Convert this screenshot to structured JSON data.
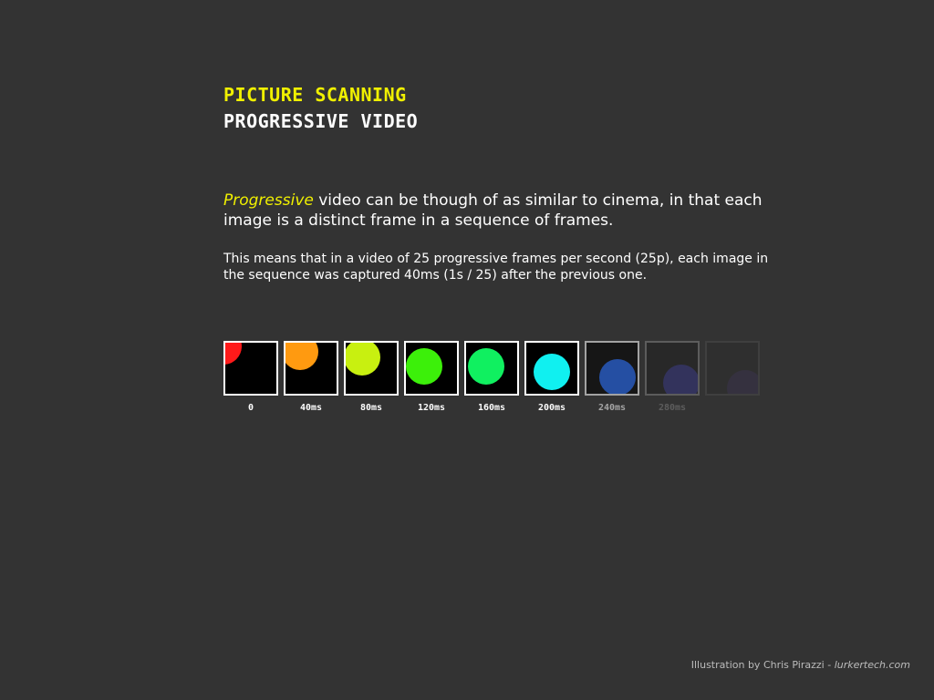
{
  "header": {
    "title": "PICTURE SCANNING",
    "subtitle": "PROGRESSIVE VIDEO"
  },
  "intro": {
    "highlight": "Progressive",
    "text": " video can be though of as similar to cinema, in that each image is a distinct frame in a sequence of frames."
  },
  "note": {
    "text": "This means that in a video of 25 progressive frames per second (25p), each image in the sequence was captured 40ms (1s / 25) after the previous one."
  },
  "frames": [
    {
      "label": "0",
      "color": "#ff1a1a",
      "opacity": 1
    },
    {
      "label": "40ms",
      "color": "#ff9a10",
      "opacity": 1
    },
    {
      "label": "80ms",
      "color": "#c8f010",
      "opacity": 1
    },
    {
      "label": "120ms",
      "color": "#3cf00a",
      "opacity": 1
    },
    {
      "label": "160ms",
      "color": "#10f060",
      "opacity": 1
    },
    {
      "label": "200ms",
      "color": "#10f0f0",
      "opacity": 1
    },
    {
      "label": "240ms",
      "color": "#1a66ff",
      "opacity": 0.55
    },
    {
      "label": "280ms",
      "color": "#3333ff",
      "opacity": 0.2
    },
    {
      "label": "",
      "color": "#5522ff",
      "opacity": 0.06
    }
  ],
  "credit": {
    "prefix": "Illustration by Chris Pirazzi - ",
    "site": "lurkertech.com"
  },
  "colors": {
    "background": "#333333",
    "accent": "#f0f000"
  }
}
